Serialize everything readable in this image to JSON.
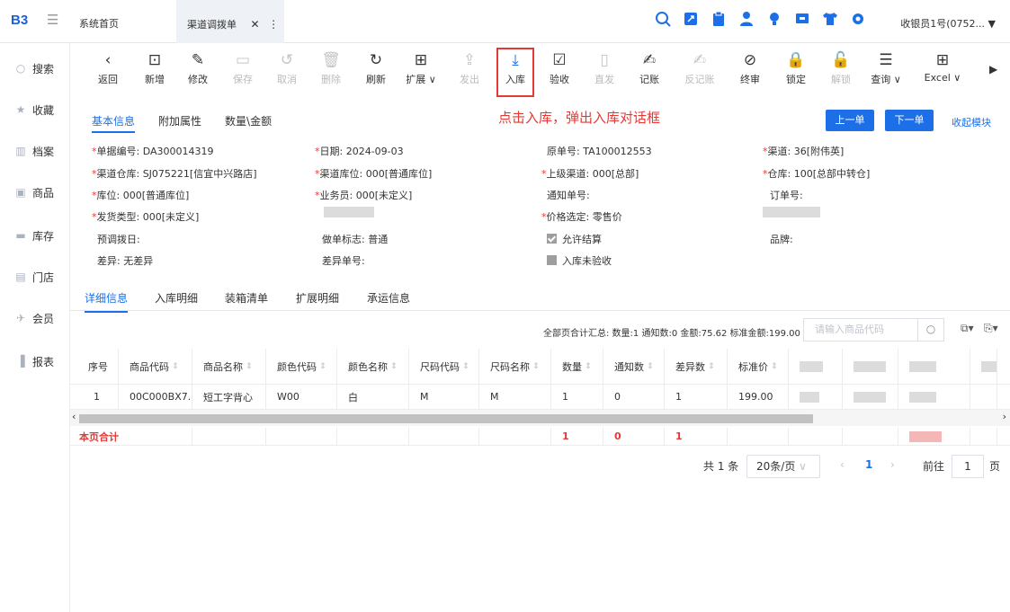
{
  "topbar": {
    "logo": "B3",
    "tabs": [
      {
        "label": "系统首页"
      },
      {
        "label": "渠道调拨单"
      }
    ],
    "user": "收银员1号(0752..."
  },
  "sidebar": {
    "items": [
      {
        "label": "搜索",
        "icon": "search-icon"
      },
      {
        "label": "收藏",
        "icon": "star-icon"
      },
      {
        "label": "档案",
        "icon": "archive-icon"
      },
      {
        "label": "商品",
        "icon": "product-icon"
      },
      {
        "label": "库存",
        "icon": "inventory-icon"
      },
      {
        "label": "门店",
        "icon": "store-icon"
      },
      {
        "label": "会员",
        "icon": "member-icon"
      },
      {
        "label": "报表",
        "icon": "report-icon"
      }
    ]
  },
  "toolbar": {
    "buttons": [
      {
        "label": "返回"
      },
      {
        "label": "新增"
      },
      {
        "label": "修改"
      },
      {
        "label": "保存"
      },
      {
        "label": "取消"
      },
      {
        "label": "删除"
      },
      {
        "label": "刷新"
      },
      {
        "label": "扩展"
      },
      {
        "label": "发出"
      },
      {
        "label": "入库"
      },
      {
        "label": "验收"
      },
      {
        "label": "直发"
      },
      {
        "label": "记账"
      },
      {
        "label": "反记账"
      },
      {
        "label": "终审"
      },
      {
        "label": "锁定"
      },
      {
        "label": "解锁"
      },
      {
        "label": "查询"
      },
      {
        "label": "Excel"
      }
    ],
    "callout": "点击入库，弹出入库对话框"
  },
  "info_tabs": {
    "items": [
      {
        "label": "基本信息"
      },
      {
        "label": "附加属性"
      },
      {
        "label": "数量\\金额"
      }
    ],
    "prev": "上一单",
    "next": "下一单",
    "collapse": "收起模块"
  },
  "form": {
    "doc_no": "单据编号: DA300014319",
    "date": "日期: 2024-09-03",
    "orig_no": "原单号: TA100012553",
    "channel": "渠道: 36[附伟英]",
    "channel_wh": "渠道仓库: SJ075221[信宜中兴路店]",
    "channel_loc": "渠道库位: 000[普通库位]",
    "parent_channel": "上级渠道: 000[总部]",
    "warehouse": "仓库: 100[总部中转仓]",
    "location": "库位: 000[普通库位]",
    "salesman": "业务员: 000[未定义]",
    "notice_no": "通知单号:",
    "order_no": "订单号:",
    "ship_type": "发货类型: 000[未定义]",
    "price_sel": "价格选定: 零售价",
    "pre_date": "预调拨日:",
    "doc_flag": "做单标志: 普通",
    "allow_settle": "允许结算",
    "brand": "品牌:",
    "diff": "差异: 无差异",
    "diff_no": "差异单号:",
    "stock_unchecked": "入库未验收"
  },
  "detail_tabs": {
    "items": [
      {
        "label": "详细信息"
      },
      {
        "label": "入库明细"
      },
      {
        "label": "装箱清单"
      },
      {
        "label": "扩展明细"
      },
      {
        "label": "承运信息"
      }
    ]
  },
  "summary": {
    "text": "全部页合计汇总:  数量:1 通知数:0 金额:75.62 标准金额:199.00",
    "search_placeholder": "请输入商品代码"
  },
  "table": {
    "columns": [
      "序号",
      "商品代码",
      "商品名称",
      "颜色代码",
      "颜色名称",
      "尺码代码",
      "尺码名称",
      "数量",
      "通知数",
      "差异数",
      "标准价"
    ],
    "rows": [
      [
        "1",
        "00C000BX7...",
        "短工字背心",
        "W00",
        "白",
        "M",
        "M",
        "1",
        "0",
        "1",
        "199.00"
      ]
    ],
    "total_label": "本页合计",
    "total_values": {
      "qty": "1",
      "notice": "0",
      "diff": "1"
    }
  },
  "pager": {
    "total": "共 1 条",
    "page_size": "20条/页",
    "current": "1",
    "goto_label": "前往",
    "goto_value": "1",
    "page_suffix": "页"
  },
  "colors": {
    "accent": "#1d6fe8",
    "alert": "#e53935"
  }
}
